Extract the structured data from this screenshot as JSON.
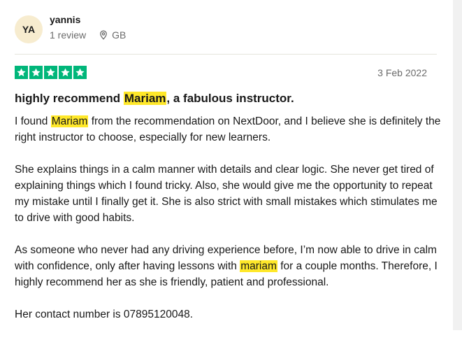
{
  "reviewer": {
    "initials": "YA",
    "name": "yannis",
    "review_count": "1 review",
    "country": "GB",
    "location_icon": "location-pin-icon"
  },
  "review": {
    "rating_stars": 5,
    "star_icon": "star-icon",
    "date": "3 Feb 2022",
    "title": {
      "before": "highly recommend ",
      "highlight": "Mariam",
      "after": ", a fabulous instructor."
    },
    "paragraphs": {
      "p1": {
        "before": "I found ",
        "highlight": "Mariam",
        "after": " from the recommendation on NextDoor, and I believe she is definitely the right instructor to choose, especially for new learners."
      },
      "p2": "She explains things in a calm manner with details and clear logic. She never get tired of explaining things which I found tricky. Also, she would give me the opportunity to repeat my mistake until I finally get it. She is also strict with small mistakes which stimulates me to drive with good habits.",
      "p3": {
        "before": "As someone who never had any driving experience before, I’m now able to drive in calm with confidence, only after having lessons with ",
        "highlight": "mariam",
        "after": " for a couple months. Therefore, I highly recommend her as she is friendly, patient and professional."
      },
      "p4": "Her contact number is 07895120048."
    }
  },
  "colors": {
    "star_green": "#00b67a",
    "highlight_yellow": "#ffe82a",
    "avatar_bg": "#f7eccf",
    "muted_text": "#6b6b6b"
  }
}
